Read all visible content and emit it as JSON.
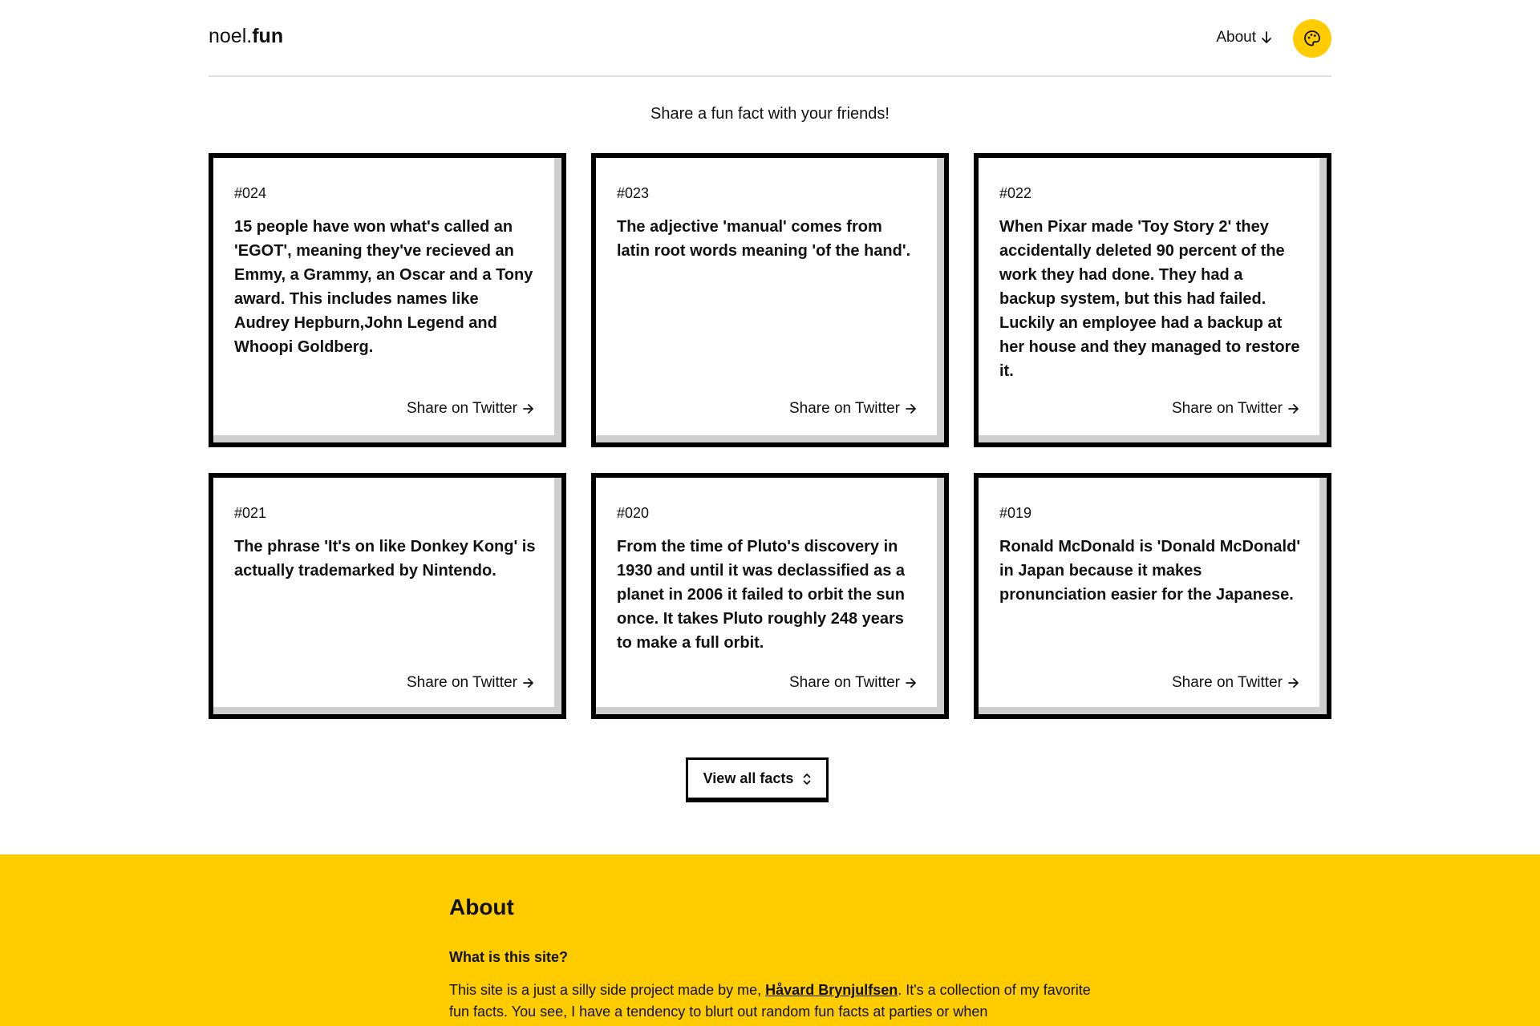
{
  "header": {
    "logo_regular": "noel.",
    "logo_bold": "fun",
    "about_label": "About"
  },
  "tagline": "Share a fun fact with your friends!",
  "cards": [
    {
      "number": "#024",
      "text": "15 people have won what's called an 'EGOT', meaning they've recieved an Emmy, a Grammy, an Oscar and a Tony award. This includes names like Audrey Hepburn,John Legend and Whoopi Goldberg.",
      "share": "Share on Twitter"
    },
    {
      "number": "#023",
      "text": "The adjective 'manual' comes from latin root words meaning 'of the hand'.",
      "share": "Share on Twitter"
    },
    {
      "number": "#022",
      "text": "When Pixar made 'Toy Story 2' they accidentally deleted 90 percent of the work they had done. They had a backup system, but this had failed. Luckily an employee had a backup at her house and they managed to restore it.",
      "share": "Share on Twitter"
    },
    {
      "number": "#021",
      "text": "The phrase 'It's on like Donkey Kong' is actually trademarked by Nintendo.",
      "share": "Share on Twitter"
    },
    {
      "number": "#020",
      "text": "From the time of Pluto's discovery in 1930 and until it was declassified as a planet in 2006 it failed to orbit the sun once. It takes Pluto roughly 248 years to make a full orbit.",
      "share": "Share on Twitter"
    },
    {
      "number": "#019",
      "text": "Ronald McDonald is 'Donald McDonald' in Japan because it makes pronunciation easier for the Japanese.",
      "share": "Share on Twitter"
    }
  ],
  "view_all_label": "View all facts",
  "footer": {
    "title": "About",
    "question": "What is this site?",
    "para_start": "This site is a just a silly side project made by me, ",
    "author_link": "Håvard Brynjulfsen",
    "para_end": ". It's a collection of my favorite fun facts. You see, I have a tendency to blurt out random fun facts at parties or when"
  },
  "colors": {
    "accent": "#ffcc00",
    "card_border": "#000000",
    "card_shadow": "#cfcfcf"
  },
  "icons": {
    "about_arrow": "arrow-down-icon",
    "palette": "palette-icon",
    "share_arrow": "arrow-right-icon",
    "view_all": "chevron-up-down-icon"
  }
}
